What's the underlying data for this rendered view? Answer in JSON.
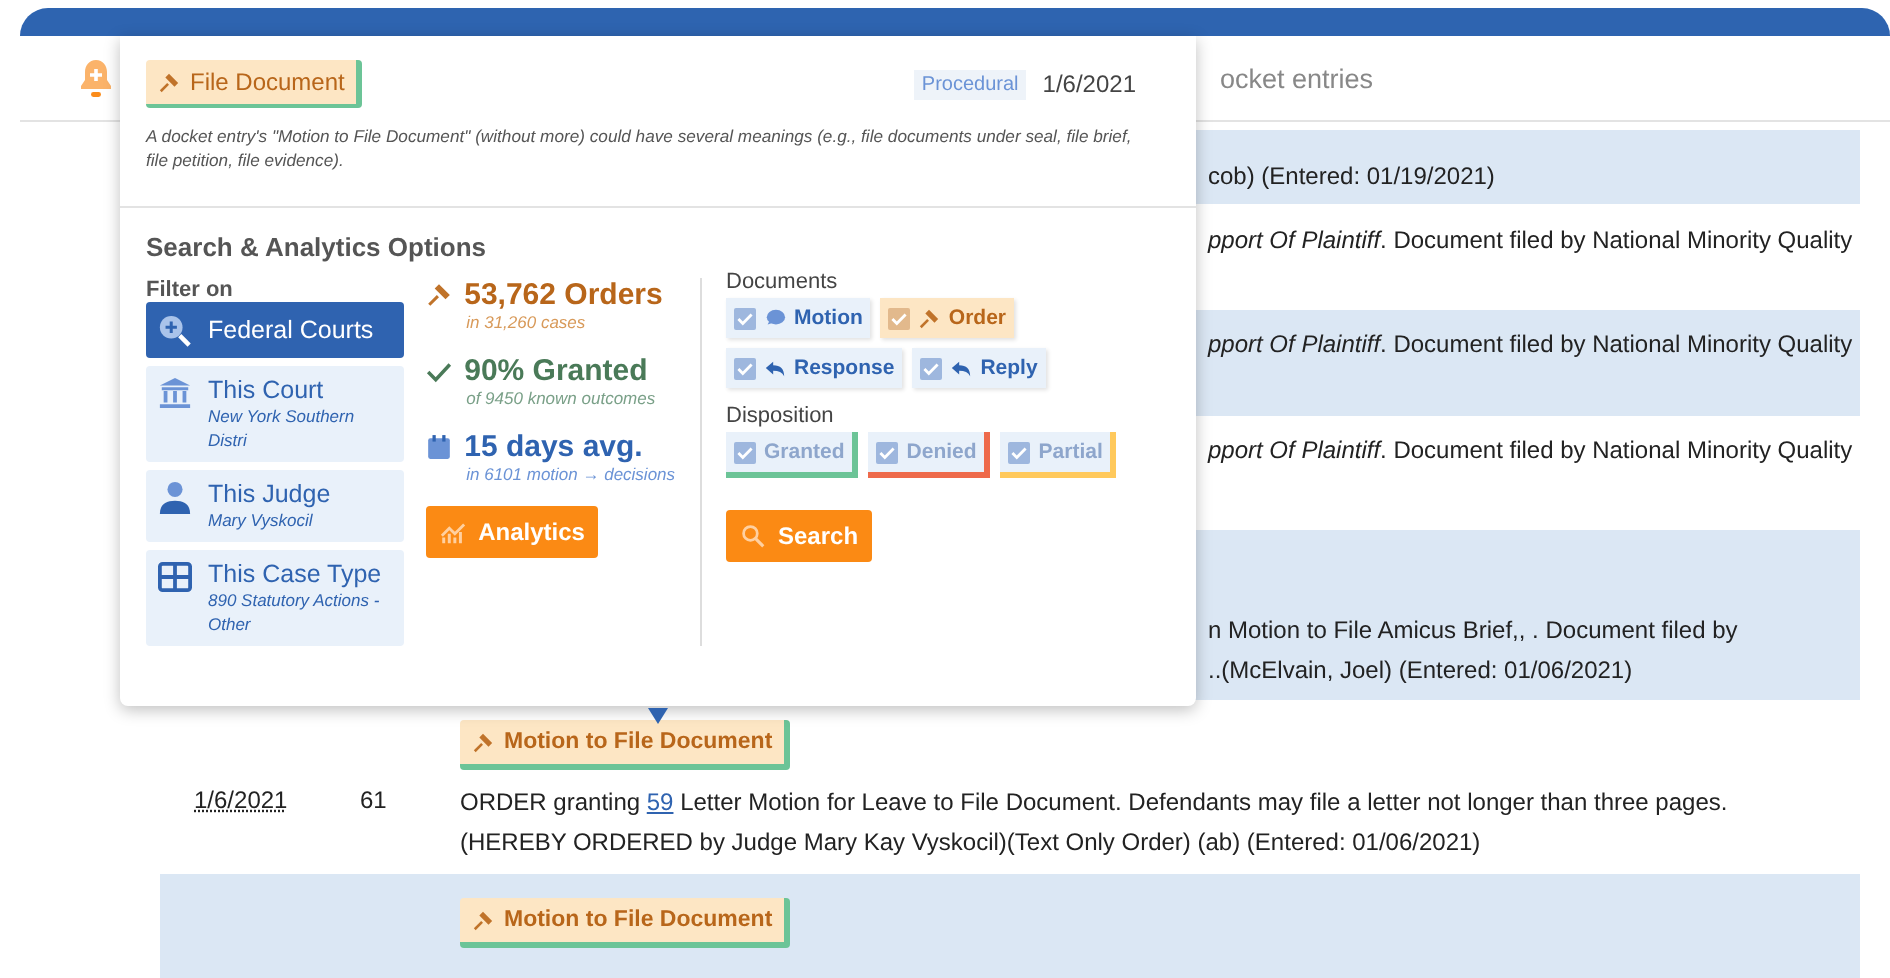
{
  "header": {
    "search_placeholder": "ocket entries"
  },
  "entries": [
    {
      "lines": [
        "cob) (Entered: 01/19/2021)"
      ]
    },
    {
      "lines": [
        "*pport Of Plaintiff*. Document filed by National Minority Quality"
      ]
    },
    {
      "lines": [
        "*pport Of Plaintiff*. Document filed by National Minority Quality"
      ]
    },
    {
      "lines": [
        "*pport Of Plaintiff*. Document filed by National Minority Quality"
      ]
    },
    {
      "lines": [
        "n Motion to File Amicus Brief,, . Document filed by",
        "..(McElvain, Joel) (Entered: 01/06/2021)"
      ]
    },
    {
      "date": "1/6/2021",
      "number": "61",
      "tag": "Motion to File Document",
      "text_before": "ORDER granting ",
      "link": "59",
      "text_after": " Letter Motion for Leave to File Document. Defendants may file a letter not longer than three pages. (HEREBY ORDERED by Judge Mary Kay Vyskocil)(Text Only Order) (ab) (Entered: 01/06/2021)"
    },
    {
      "tag": "Motion to File Document"
    }
  ],
  "popup": {
    "tag": "File Document",
    "category": "Procedural",
    "date": "1/6/2021",
    "note": "A docket entry's \"Motion to File Document\" (without more) could have several meanings (e.g., file documents under seal, file brief, file petition, file evidence).",
    "title": "Search & Analytics Options",
    "filter_label": "Filter on",
    "filters": [
      {
        "kind": "courts",
        "label": "Federal Courts",
        "selected": true
      },
      {
        "kind": "court",
        "label": "This Court",
        "sub": "New York Southern Distri",
        "selected": false
      },
      {
        "kind": "judge",
        "label": "This Judge",
        "sub": "Mary Vyskocil",
        "selected": false
      },
      {
        "kind": "case_type",
        "label": "This Case Type",
        "sub": "890 Statutory Actions - Other",
        "selected": false
      }
    ],
    "stats": [
      {
        "kind": "orders",
        "value": "53,762 Orders",
        "sub": "in 31,260 cases"
      },
      {
        "kind": "granted",
        "value": "90% Granted",
        "sub": "of 9450 known outcomes"
      },
      {
        "kind": "days",
        "value": "15 days avg.",
        "sub": "in 6101 motion → decisions"
      }
    ],
    "analytics_button": "Analytics",
    "documents_label": "Documents",
    "documents": [
      {
        "kind": "motion",
        "label": "Motion",
        "checked": true
      },
      {
        "kind": "order",
        "label": "Order",
        "checked": true
      },
      {
        "kind": "response",
        "label": "Response",
        "checked": true
      },
      {
        "kind": "reply",
        "label": "Reply",
        "checked": true
      }
    ],
    "disposition_label": "Disposition",
    "dispositions": [
      {
        "label": "Granted",
        "checked": true,
        "color": "#6cc497"
      },
      {
        "label": "Denied",
        "checked": true,
        "color": "#ee6a4b"
      },
      {
        "label": "Partial",
        "checked": true,
        "color": "#ffc95c"
      }
    ],
    "search_button": "Search"
  }
}
